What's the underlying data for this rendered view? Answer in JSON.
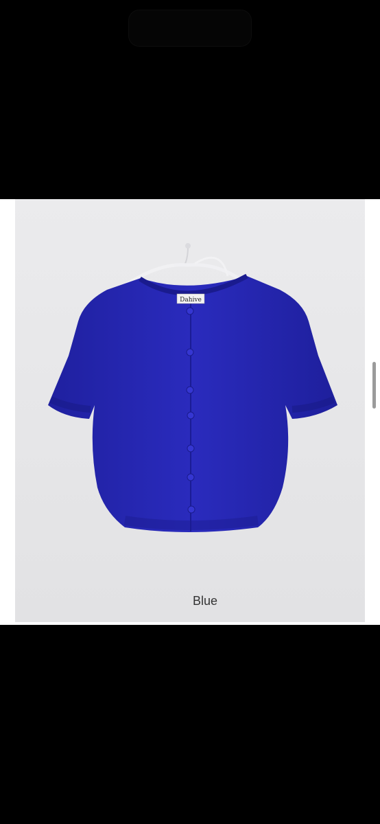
{
  "product": {
    "color_caption": "Blue",
    "brand_tag_text": "Dahive",
    "garment_color": "#2526b4"
  },
  "screen": {
    "background": "#000000",
    "photo_background": "#e5e5e7"
  }
}
